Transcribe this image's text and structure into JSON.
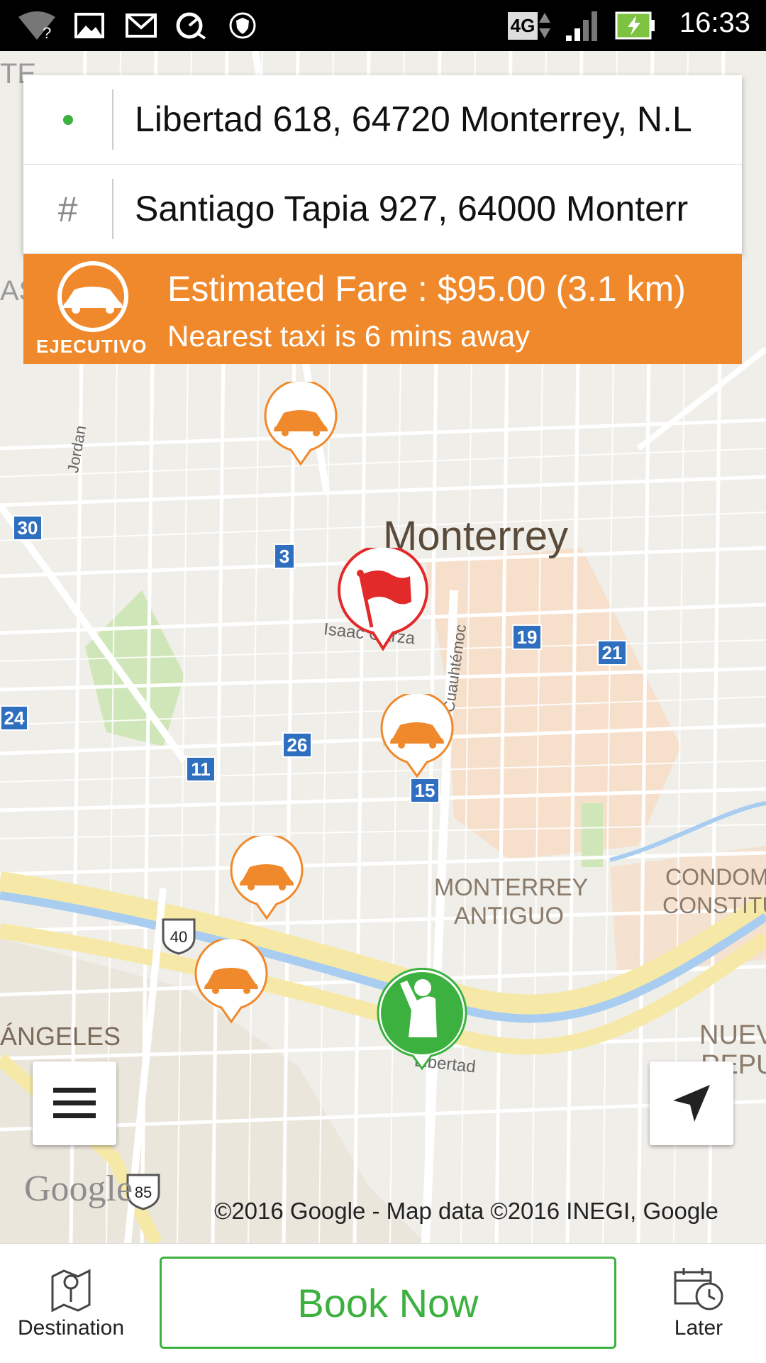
{
  "status_bar": {
    "time": "16:33",
    "network": "4G",
    "icons": [
      "wifi-question-icon",
      "image-icon",
      "gmail-icon",
      "speed-icon",
      "shield-icon",
      "network-4g-icon",
      "signal-icon",
      "battery-charging-icon"
    ]
  },
  "pickup": {
    "address": "Libertad 618, 64720 Monterrey, N.L",
    "icon": "green-dot-icon"
  },
  "destination": {
    "address": "Santiago Tapia 927, 64000 Monterr",
    "icon": "hash-icon",
    "symbol": "#"
  },
  "fare": {
    "car_class": "EJECUTIVO",
    "estimate": "Estimated Fare : $95.00 (3.1 km)",
    "nearest": "Nearest taxi is 6 mins away",
    "color": "#f0892b"
  },
  "map": {
    "city_label": "Monterrey",
    "district_1": "MONTERREY",
    "district_2": "ANTIGUO",
    "condom_1": "CONDOM",
    "condom_2": "CONSTITU",
    "angeles": "ÁNGELES",
    "nuev_1": "NUEV",
    "nuev_2": "REPUE",
    "te_label": "TE",
    "as_label": "AS",
    "streets": {
      "jordan": "Jordan",
      "isaac": "Isaac Garza",
      "cuauhtemoc": "Cuauhtémoc",
      "libertad": "Libertad"
    },
    "route_badges": [
      "30",
      "3",
      "19",
      "21",
      "24",
      "26",
      "11",
      "15"
    ],
    "highways": [
      "40",
      "85"
    ],
    "google_logo": "Google",
    "attribution": "©2016 Google - Map data ©2016 INEGI, Google"
  },
  "controls": {
    "menu_icon": "hamburger-menu-icon",
    "locate_icon": "navigation-arrow-icon"
  },
  "bottom_bar": {
    "destination_label": "Destination",
    "book_label": "Book Now",
    "later_label": "Later",
    "accent": "#3cb13f"
  }
}
